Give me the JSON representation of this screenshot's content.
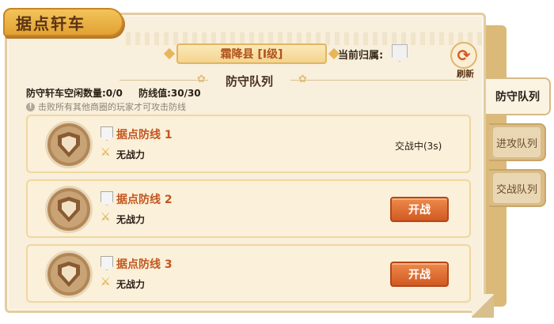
{
  "title": "据点轩车",
  "county": "霜降县 [I级]",
  "owner_label": "当前归属:",
  "refresh_label": "刷新",
  "section_title": "防守队列",
  "stats": {
    "idle_count": "防守轩车空闲数量:0/0",
    "defense_value": "防线值:30/30"
  },
  "hint": "击败所有其他商圈的玩家才可攻击防线",
  "defense_lines": [
    {
      "name": "据点防线 1",
      "power": "无战力",
      "status": "交战中(3s)"
    },
    {
      "name": "据点防线 2",
      "power": "无战力",
      "button": "开战"
    },
    {
      "name": "据点防线 3",
      "power": "无战力",
      "button": "开战"
    }
  ],
  "tabs": [
    "防守队列",
    "进攻队列",
    "交战队列"
  ],
  "colors": {
    "accent": "#d15a22",
    "title_gold": "#e2a132",
    "panel": "#f8efdc"
  }
}
